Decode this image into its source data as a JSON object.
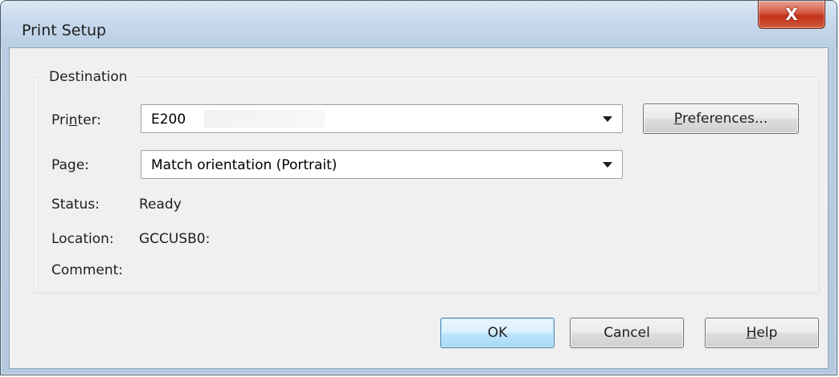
{
  "window": {
    "title": "Print Setup",
    "close_glyph": "X"
  },
  "destination": {
    "legend": "Destination",
    "printer_label_pre": "Pri",
    "printer_label_ul": "n",
    "printer_label_post": "ter:",
    "printer_value": "E200",
    "page_label_pre": "Pa",
    "page_label_ul": "g",
    "page_label_post": "e:",
    "page_value": "Match orientation (Portrait)",
    "status_label": "Status:",
    "status_value": "Ready",
    "location_label": "Location:",
    "location_value": "GCCUSB0:",
    "comment_label": "Comment:",
    "comment_value": ""
  },
  "buttons": {
    "preferences_ul": "P",
    "preferences_rest": "references...",
    "ok": "OK",
    "cancel": "Cancel",
    "help_ul": "H",
    "help_rest": "elp"
  },
  "icons": {
    "close": "close-icon",
    "dropdown": "chevron-down-icon"
  },
  "colors": {
    "default_button_border": "#3c7fb1",
    "close_button": "#c0321c",
    "dialog_background": "#f0f0f0"
  }
}
